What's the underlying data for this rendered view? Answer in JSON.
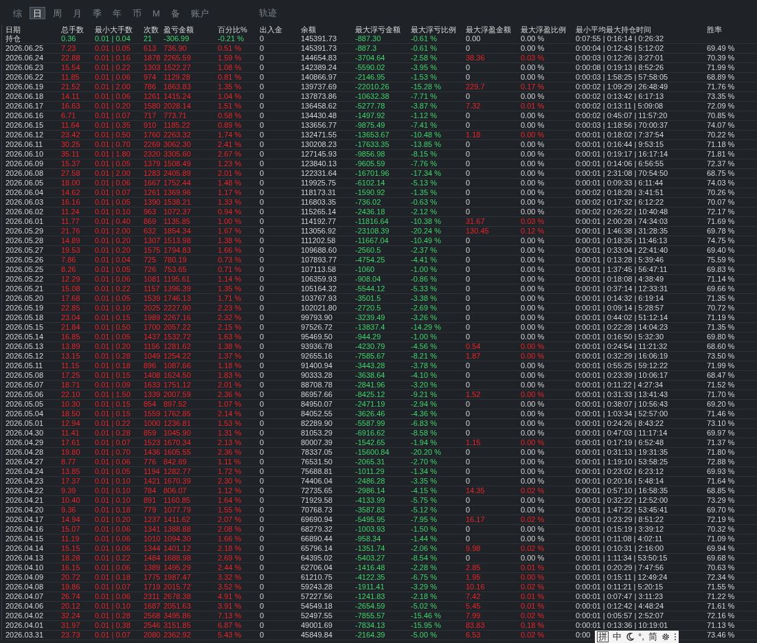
{
  "tabs": [
    {
      "label": "综",
      "selected": false
    },
    {
      "label": "日",
      "selected": true
    },
    {
      "label": "周",
      "selected": false
    },
    {
      "label": "月",
      "selected": false
    },
    {
      "label": "季",
      "selected": false
    },
    {
      "label": "年",
      "selected": false
    },
    {
      "label": "币",
      "selected": false
    },
    {
      "label": "M",
      "selected": false
    },
    {
      "label": "备",
      "selected": false
    },
    {
      "label": "账户",
      "selected": false
    }
  ],
  "trail_tab": {
    "label": "轨迹"
  },
  "table": {
    "columns": [
      "日期",
      "总手数",
      "最小大手数",
      "次数",
      "盈亏金额",
      "百分比%",
      "出入金",
      "余额",
      "最大浮亏金额",
      "最大浮亏比例",
      "最大浮盈金额",
      "最大浮盈比例",
      "最小平均最大持仓时间",
      "胜率"
    ],
    "rows": [
      {
        "profit": false,
        "float_gain": false,
        "cells": [
          "持仓",
          "0.36",
          "0.01 | 0.04",
          "21",
          "-306.99",
          "-0.21 %",
          "0",
          "145391.73",
          "-887.30",
          "-0.61 %",
          "0.00",
          "0.00 %",
          "0:07:55 | 0:16:14 | 0:26:32"
        ]
      },
      {
        "profit": true,
        "float_gain": false,
        "cells": [
          "2026.06.25",
          "7.23",
          "0.01 | 0.05",
          "613",
          "736.90",
          "0.51 %",
          "0",
          "145391.73",
          "-887.3",
          "-0.61 %",
          "0",
          "0.00 %",
          "0:00:04 | 0:12:43 | 5:12:02",
          "69.49 %"
        ]
      },
      {
        "profit": true,
        "float_gain": true,
        "cells": [
          "2026.06.24",
          "22.88",
          "0.01 | 0.16",
          "1878",
          "2265.59",
          "1.59 %",
          "0",
          "144654.83",
          "-3704.64",
          "-2.58 %",
          "38.36",
          "0.03 %",
          "0:00:03 | 0:12:26 | 3:27:01",
          "70.39 %"
        ]
      },
      {
        "profit": true,
        "float_gain": false,
        "cells": [
          "2026.06.23",
          "15.54",
          "0.01 | 0.22",
          "1303",
          "1522.27",
          "1.08 %",
          "0",
          "142389.24",
          "-5590.02",
          "-3.95 %",
          "0",
          "0.00 %",
          "0:00:08 | 0:19:13 | 8:52:26",
          "71.99 %"
        ]
      },
      {
        "profit": true,
        "float_gain": false,
        "cells": [
          "2026.06.22",
          "11.85",
          "0.01 | 0.06",
          "974",
          "1129.28",
          "0.81 %",
          "0",
          "140866.97",
          "-2146.95",
          "-1.53 %",
          "0",
          "0.00 %",
          "0:00:03 | 1:58:25 | 57:58:05",
          "68.89 %"
        ]
      },
      {
        "profit": true,
        "float_gain": true,
        "cells": [
          "2026.06.19",
          "21.52",
          "0.01 | 2.00",
          "786",
          "1863.83",
          "1.35 %",
          "0",
          "139737.69",
          "-22010.26",
          "-15.28 %",
          "229.7",
          "0.17 %",
          "0:00:02 | 1:09:29 | 26:48:49",
          "71.76 %"
        ]
      },
      {
        "profit": true,
        "float_gain": false,
        "cells": [
          "2026.06.18",
          "14.11",
          "0.01 | 0.06",
          "1261",
          "1415.24",
          "1.04 %",
          "0",
          "137873.86",
          "-10632.38",
          "-7.71 %",
          "0",
          "0.00 %",
          "0:00:02 | 0:13:42 | 6:17:13",
          "73.35 %"
        ]
      },
      {
        "profit": true,
        "float_gain": true,
        "cells": [
          "2026.06.17",
          "16.63",
          "0.01 | 0.20",
          "1580",
          "2028.14",
          "1.51 %",
          "0",
          "136458.62",
          "-5277.78",
          "-3.87 %",
          "7.32",
          "0.01 %",
          "0:00:02 | 0:13:11 | 5:09:08",
          "72.09 %"
        ]
      },
      {
        "profit": true,
        "float_gain": false,
        "cells": [
          "2026.06.16",
          "6.71",
          "0.01 | 0.07",
          "717",
          "773.71",
          "0.58 %",
          "0",
          "134430.48",
          "-1497.92",
          "-1.12 %",
          "0",
          "0.00 %",
          "0:00:02 | 0:45:07 | 11:57:20",
          "70.85 %"
        ]
      },
      {
        "profit": true,
        "float_gain": false,
        "cells": [
          "2026.06.15",
          "11.64",
          "0.01 | 0.35",
          "910",
          "1185.22",
          "0.89 %",
          "0",
          "133656.77",
          "-9875.49",
          "-7.41 %",
          "0",
          "0.00 %",
          "0:00:03 | 1:18:56 | 70:00:37",
          "74.07 %"
        ]
      },
      {
        "profit": true,
        "float_gain": true,
        "cells": [
          "2026.06.12",
          "23.42",
          "0.01 | 0.50",
          "1760",
          "2263.32",
          "1.74 %",
          "0",
          "132471.55",
          "-13653.67",
          "-10.48 %",
          "1.18",
          "0.00 %",
          "0:00:01 | 0:18:02 | 7:37:54",
          "70.22 %"
        ]
      },
      {
        "profit": true,
        "float_gain": false,
        "cells": [
          "2026.06.11",
          "30.25",
          "0.01 | 0.70",
          "2269",
          "3062.30",
          "2.41 %",
          "0",
          "130208.23",
          "-17633.35",
          "-13.85 %",
          "0",
          "0.00 %",
          "0:00:01 | 0:16:44 | 9:53:15",
          "71.18 %"
        ]
      },
      {
        "profit": true,
        "float_gain": false,
        "cells": [
          "2026.06.10",
          "35.11",
          "0.01 | 1.80",
          "2320",
          "3305.60",
          "2.67 %",
          "0",
          "127145.93",
          "-9856.98",
          "-8.15 %",
          "0",
          "0.00 %",
          "0:00:01 | 0:19:17 | 16:17:14",
          "71.81 %"
        ]
      },
      {
        "profit": true,
        "float_gain": false,
        "cells": [
          "2026.06.09",
          "15.37",
          "0.01 | 0.05",
          "1379",
          "1508.49",
          "1.23 %",
          "0",
          "123840.13",
          "-9605.59",
          "-7.76 %",
          "0",
          "0.00 %",
          "0:00:01 | 0:14:06 | 6:56:55",
          "72.37 %"
        ]
      },
      {
        "profit": true,
        "float_gain": false,
        "cells": [
          "2026.06.08",
          "27.58",
          "0.01 | 2.00",
          "1283",
          "2405.89",
          "2.01 %",
          "0",
          "122331.64",
          "-16701.96",
          "-17.34 %",
          "0",
          "0.00 %",
          "0:00:01 | 2:31:08 | 70:54:50",
          "68.75 %"
        ]
      },
      {
        "profit": true,
        "float_gain": false,
        "cells": [
          "2026.06.05",
          "18.00",
          "0.01 | 0.06",
          "1667",
          "1752.44",
          "1.48 %",
          "0",
          "119925.75",
          "-6102.14",
          "-5.13 %",
          "0",
          "0.00 %",
          "0:00:01 | 0:09:33 | 6:11:44",
          "74.03 %"
        ]
      },
      {
        "profit": true,
        "float_gain": false,
        "cells": [
          "2026.06.04",
          "14.62",
          "0.01 | 0.07",
          "1261",
          "1369.96",
          "1.17 %",
          "0",
          "118173.31",
          "-1590.92",
          "-1.35 %",
          "0",
          "0.00 %",
          "0:00:02 | 0:18:28 | 3:41:51",
          "70.26 %"
        ]
      },
      {
        "profit": true,
        "float_gain": false,
        "cells": [
          "2026.06.03",
          "16.16",
          "0.01 | 0.05",
          "1390",
          "1538.21",
          "1.33 %",
          "0",
          "116803.35",
          "-736.02",
          "-0.63 %",
          "0",
          "0.00 %",
          "0:00:02 | 0:17:32 | 6:12:22",
          "70.07 %"
        ]
      },
      {
        "profit": true,
        "float_gain": false,
        "cells": [
          "2026.06.02",
          "11.24",
          "0.01 | 0.10",
          "963",
          "1072.37",
          "0.94 %",
          "0",
          "115265.14",
          "-2436.18",
          "-2.12 %",
          "0",
          "0.00 %",
          "0:00:02 | 0:26:22 | 10:40:48",
          "72.17 %"
        ]
      },
      {
        "profit": true,
        "float_gain": true,
        "cells": [
          "2026.06.01",
          "11.77",
          "0.01 | 0.40",
          "869",
          "1135.85",
          "1.00 %",
          "0",
          "114192.77",
          "-11816.64",
          "-10.38 %",
          "31.67",
          "0.03 %",
          "0:00:01 | 2:00:28 | 74:34:03",
          "71.69 %"
        ]
      },
      {
        "profit": true,
        "float_gain": true,
        "cells": [
          "2026.05.29",
          "21.76",
          "0.01 | 2.00",
          "632",
          "1854.34",
          "1.67 %",
          "0",
          "113056.92",
          "-23108.39",
          "-20.24 %",
          "130.45",
          "0.12 %",
          "0:00:01 | 1:46:38 | 31:28:35",
          "69.78 %"
        ]
      },
      {
        "profit": true,
        "float_gain": false,
        "cells": [
          "2026.05.28",
          "14.89",
          "0.01 | 0.20",
          "1307",
          "1513.98",
          "1.38 %",
          "0",
          "111202.58",
          "-11667.04",
          "-10.49 %",
          "0",
          "0.00 %",
          "0:00:01 | 0:18:35 | 11:46:13",
          "74.75 %"
        ]
      },
      {
        "profit": true,
        "float_gain": false,
        "cells": [
          "2026.05.27",
          "19.53",
          "0.01 | 0.20",
          "1575",
          "1794.83",
          "1.66 %",
          "0",
          "109688.60",
          "-2560.5",
          "-2.37 %",
          "0",
          "0.00 %",
          "0:00:01 | 0:33:04 | 22:41:40",
          "69.40 %"
        ]
      },
      {
        "profit": true,
        "float_gain": false,
        "cells": [
          "2026.05.26",
          "7.86",
          "0.01 | 0.04",
          "725",
          "780.19",
          "0.73 %",
          "0",
          "107893.77",
          "-4754.25",
          "-4.41 %",
          "0",
          "0.00 %",
          "0:00:01 | 0:13:28 | 5:39:46",
          "75.59 %"
        ]
      },
      {
        "profit": true,
        "float_gain": false,
        "cells": [
          "2026.05.25",
          "8.26",
          "0.01 | 0.05",
          "726",
          "753.65",
          "0.71 %",
          "0",
          "107113.58",
          "-1060",
          "-1.00 %",
          "0",
          "0.00 %",
          "0:00:01 | 1:37:45 | 56:47:11",
          "69.83 %"
        ]
      },
      {
        "profit": true,
        "float_gain": false,
        "cells": [
          "2026.05.22",
          "12.29",
          "0.01 | 0.06",
          "1081",
          "1195.61",
          "1.14 %",
          "0",
          "106359.93",
          "-908.04",
          "-0.86 %",
          "0",
          "0.00 %",
          "0:00:01 | 0:18:08 | 4:38:49",
          "71.14 %"
        ]
      },
      {
        "profit": true,
        "float_gain": false,
        "cells": [
          "2026.05.21",
          "15.08",
          "0.01 | 0.22",
          "1157",
          "1396.39",
          "1.35 %",
          "0",
          "105164.32",
          "-5544.12",
          "-5.33 %",
          "0",
          "0.00 %",
          "0:00:01 | 0:37:14 | 12:33:31",
          "69.66 %"
        ]
      },
      {
        "profit": true,
        "float_gain": false,
        "cells": [
          "2026.05.20",
          "17.68",
          "0.01 | 0.05",
          "1539",
          "1746.13",
          "1.71 %",
          "0",
          "103767.93",
          "-3501.5",
          "-3.38 %",
          "0",
          "0.00 %",
          "0:00:01 | 0:14:32 | 6:19:14",
          "71.35 %"
        ]
      },
      {
        "profit": true,
        "float_gain": false,
        "cells": [
          "2026.05.19",
          "22.85",
          "0.01 | 0.10",
          "2025",
          "2227.90",
          "2.23 %",
          "0",
          "102021.80",
          "-2720.5",
          "-2.69 %",
          "0",
          "0.00 %",
          "0:00:01 | 0:09:14 | 5:28:57",
          "70.72 %"
        ]
      },
      {
        "profit": true,
        "float_gain": false,
        "cells": [
          "2026.05.18",
          "23.04",
          "0.01 | 0.15",
          "1989",
          "2267.16",
          "2.32 %",
          "0",
          "99793.90",
          "-3239.49",
          "-3.26 %",
          "0",
          "0.00 %",
          "0:00:01 | 0:44:02 | 51:12:14",
          "71.19 %"
        ]
      },
      {
        "profit": true,
        "float_gain": false,
        "cells": [
          "2026.05.15",
          "21.84",
          "0.01 | 0.50",
          "1700",
          "2057.22",
          "2.15 %",
          "0",
          "97526.72",
          "-13837.4",
          "-14.29 %",
          "0",
          "0.00 %",
          "0:00:01 | 0:22:28 | 14:04:23",
          "71.35 %"
        ]
      },
      {
        "profit": true,
        "float_gain": false,
        "cells": [
          "2026.05.14",
          "16.85",
          "0.01 | 0.05",
          "1437",
          "1532.72",
          "1.63 %",
          "0",
          "95469.50",
          "-944.29",
          "-1.00 %",
          "0",
          "0.00 %",
          "0:00:01 | 0:16:50 | 5:32:30",
          "69.80 %"
        ]
      },
      {
        "profit": true,
        "float_gain": true,
        "cells": [
          "2026.05.13",
          "13.89",
          "0.01 | 0.20",
          "1156",
          "1281.62",
          "1.38 %",
          "0",
          "93936.78",
          "-4230.79",
          "-4.56 %",
          "0.54",
          "0.00 %",
          "0:00:01 | 0:24:54 | 11:21:32",
          "68.60 %"
        ]
      },
      {
        "profit": true,
        "float_gain": true,
        "cells": [
          "2026.05.12",
          "13.15",
          "0.01 | 0.28",
          "1049",
          "1254.22",
          "1.37 %",
          "0",
          "92655.16",
          "-7585.67",
          "-8.21 %",
          "1.87",
          "0.00 %",
          "0:00:01 | 0:32:29 | 16:06:19",
          "73.50 %"
        ]
      },
      {
        "profit": true,
        "float_gain": false,
        "cells": [
          "2026.05.11",
          "11.15",
          "0.01 | 0.18",
          "896",
          "1087.66",
          "1.18 %",
          "0",
          "91400.94",
          "-3443.28",
          "-3.78 %",
          "0",
          "0.00 %",
          "0:00:01 | 0:55:25 | 59:12:22",
          "71.99 %"
        ]
      },
      {
        "profit": true,
        "float_gain": false,
        "cells": [
          "2026.05.08",
          "17.25",
          "0.01 | 0.15",
          "1408",
          "1624.50",
          "1.83 %",
          "0",
          "90333.28",
          "-3638.64",
          "-4.10 %",
          "0",
          "0.00 %",
          "0:00:01 | 0:23:39 | 10:06:17",
          "68.47 %"
        ]
      },
      {
        "profit": true,
        "float_gain": false,
        "cells": [
          "2026.05.07",
          "18.71",
          "0.01 | 0.09",
          "1633",
          "1751.12",
          "2.01 %",
          "0",
          "88708.78",
          "-2841.96",
          "-3.20 %",
          "0",
          "0.00 %",
          "0:00:01 | 0:11:22 | 4:27:34",
          "71.52 %"
        ]
      },
      {
        "profit": true,
        "float_gain": true,
        "cells": [
          "2026.05.06",
          "22.10",
          "0.01 | 1.50",
          "1339",
          "2007.59",
          "2.36 %",
          "0",
          "86957.66",
          "-8425.12",
          "-9.21 %",
          "1.52",
          "0.00 %",
          "0:00:01 | 0:31:33 | 13:41:43",
          "71.70 %"
        ]
      },
      {
        "profit": true,
        "float_gain": false,
        "cells": [
          "2026.05.05",
          "10.30",
          "0.01 | 0.15",
          "854",
          "897.52",
          "1.07 %",
          "0",
          "84950.07",
          "-2471.19",
          "-2.94 %",
          "0",
          "0.00 %",
          "0:00:01 | 0:38:07 | 10:56:43",
          "69.20 %"
        ]
      },
      {
        "profit": true,
        "float_gain": false,
        "cells": [
          "2026.05.04",
          "18.50",
          "0.01 | 0.15",
          "1559",
          "1762.85",
          "2.14 %",
          "0",
          "84052.55",
          "-3626.46",
          "-4.36 %",
          "0",
          "0.00 %",
          "0:00:01 | 1:03:34 | 52:57:00",
          "71.46 %"
        ]
      },
      {
        "profit": true,
        "float_gain": false,
        "cells": [
          "2026.05.01",
          "12.94",
          "0.01 | 0.22",
          "1000",
          "1236.81",
          "1.53 %",
          "0",
          "82289.90",
          "-5587.99",
          "-6.83 %",
          "0",
          "0.00 %",
          "0:00:01 | 0:24:26 | 8:43:22",
          "73.10 %"
        ]
      },
      {
        "profit": true,
        "float_gain": false,
        "cells": [
          "2026.04.30",
          "11.41",
          "0.01 | 0.28",
          "859",
          "1045.90",
          "1.31 %",
          "0",
          "81053.29",
          "-6916.62",
          "-8.58 %",
          "0",
          "0.00 %",
          "0:00:01 | 0:47:03 | 11:17:14",
          "69.97 %"
        ]
      },
      {
        "profit": true,
        "float_gain": true,
        "cells": [
          "2026.04.29",
          "17.61",
          "0.01 | 0.07",
          "1523",
          "1670.34",
          "2.13 %",
          "0",
          "80007.39",
          "-1542.65",
          "-1.94 %",
          "1.15",
          "0.00 %",
          "0:00:01 | 0:17:19 | 6:52:48",
          "71.37 %"
        ]
      },
      {
        "profit": true,
        "float_gain": false,
        "cells": [
          "2026.04.28",
          "19.80",
          "0.01 | 0.70",
          "1436",
          "1605.55",
          "2.36 %",
          "0",
          "78337.05",
          "-15600.84",
          "-20.20 %",
          "0",
          "0.00 %",
          "0:00:01 | 0:31:13 | 19:31:35",
          "71.80 %"
        ]
      },
      {
        "profit": true,
        "float_gain": false,
        "cells": [
          "2026.04.27",
          "8.77",
          "0.01 | 0.06",
          "776",
          "842.69",
          "1.11 %",
          "0",
          "76531.50",
          "-2065.31",
          "-2.70 %",
          "0",
          "0.00 %",
          "0:00:01 | 1:19:10 | 53:58:25",
          "72.88 %"
        ]
      },
      {
        "profit": true,
        "float_gain": false,
        "cells": [
          "2026.04.24",
          "13.85",
          "0.01 | 0.05",
          "1194",
          "1282.77",
          "1.72 %",
          "0",
          "75688.81",
          "-1011.29",
          "-1.34 %",
          "0",
          "0.00 %",
          "0:00:01 | 0:23:02 | 6:23:12",
          "69.93 %"
        ]
      },
      {
        "profit": true,
        "float_gain": false,
        "cells": [
          "2026.04.23",
          "17.37",
          "0.01 | 0.10",
          "1421",
          "1670.39",
          "2.30 %",
          "0",
          "74406.04",
          "-2486.28",
          "-3.35 %",
          "0",
          "0.00 %",
          "0:00:01 | 0:20:16 | 5:48:14",
          "71.64 %"
        ]
      },
      {
        "profit": true,
        "float_gain": true,
        "cells": [
          "2026.04.22",
          "9.39",
          "0.01 | 0.10",
          "784",
          "806.07",
          "1.12 %",
          "0",
          "72735.65",
          "-2986.14",
          "-4.15 %",
          "14.35",
          "0.02 %",
          "0:00:01 | 0:57:10 | 16:58:35",
          "68.85 %"
        ]
      },
      {
        "profit": true,
        "float_gain": false,
        "cells": [
          "2026.04.21",
          "10.40",
          "0.01 | 0.10",
          "891",
          "1160.85",
          "1.64 %",
          "0",
          "71929.58",
          "-4133.99",
          "-5.75 %",
          "0",
          "0.00 %",
          "0:00:01 | 0:32:22 | 12:52:00",
          "73.29 %"
        ]
      },
      {
        "profit": true,
        "float_gain": false,
        "cells": [
          "2026.04.20",
          "9.36",
          "0.01 | 0.18",
          "779",
          "1077.79",
          "1.55 %",
          "0",
          "70768.73",
          "-3587.83",
          "-5.12 %",
          "0",
          "0.00 %",
          "0:00:01 | 1:47:22 | 53:45:41",
          "69.70 %"
        ]
      },
      {
        "profit": true,
        "float_gain": true,
        "cells": [
          "2026.04.17",
          "14.94",
          "0.01 | 0.20",
          "1237",
          "1411.62",
          "2.07 %",
          "0",
          "69690.94",
          "-5495.95",
          "-7.95 %",
          "16.17",
          "0.02 %",
          "0:00:01 | 0:23:29 | 8:51:22",
          "72.19 %"
        ]
      },
      {
        "profit": true,
        "float_gain": false,
        "cells": [
          "2026.04.16",
          "15.07",
          "0.01 | 0.06",
          "1341",
          "1388.88",
          "2.08 %",
          "0",
          "68279.32",
          "-1003.93",
          "-1.50 %",
          "0",
          "0.00 %",
          "0:00:01 | 0:15:19 | 3:39:12",
          "70.32 %"
        ]
      },
      {
        "profit": true,
        "float_gain": false,
        "cells": [
          "2026.04.15",
          "11.19",
          "0.01 | 0.06",
          "1010",
          "1094.30",
          "1.66 %",
          "0",
          "66890.44",
          "-958.34",
          "-1.44 %",
          "0",
          "0.00 %",
          "0:00:01 | 0:11:08 | 4:02:11",
          "71.09 %"
        ]
      },
      {
        "profit": true,
        "float_gain": true,
        "cells": [
          "2026.04.14",
          "15.15",
          "0.01 | 0.06",
          "1344",
          "1401.12",
          "2.18 %",
          "0",
          "65796.14",
          "-1351.74",
          "-2.06 %",
          "9.98",
          "0.02 %",
          "0:00:01 | 0:10:31 | 2:16:00",
          "69.94 %"
        ]
      },
      {
        "profit": true,
        "float_gain": false,
        "cells": [
          "2026.04.13",
          "18.28",
          "0.01 | 0.22",
          "1484",
          "1688.98",
          "2.69 %",
          "0",
          "64395.02",
          "-5403.27",
          "-8.54 %",
          "0",
          "0.00 %",
          "0:00:01 | 1:11:34 | 53:50:15",
          "69.68 %"
        ]
      },
      {
        "profit": true,
        "float_gain": true,
        "cells": [
          "2026.04.10",
          "16.15",
          "0.01 | 0.06",
          "1389",
          "1495.29",
          "2.44 %",
          "0",
          "62706.04",
          "-1416.48",
          "-2.28 %",
          "2.85",
          "0.01 %",
          "0:00:01 | 0:20:29 | 7:47:56",
          "70.63 %"
        ]
      },
      {
        "profit": true,
        "float_gain": true,
        "cells": [
          "2026.04.09",
          "20.72",
          "0.01 | 0.18",
          "1775",
          "1987.47",
          "3.32 %",
          "0",
          "61210.75",
          "-4122.35",
          "-6.75 %",
          "1.95",
          "0.00 %",
          "0:00:01 | 0:15:11 | 12:49:24",
          "72.34 %"
        ]
      },
      {
        "profit": true,
        "float_gain": true,
        "cells": [
          "2026.04.08",
          "19.86",
          "0.01 | 0.07",
          "1719",
          "2015.72",
          "3.52 %",
          "0",
          "59243.28",
          "-1911.41",
          "-3.29 %",
          "10.16",
          "0.02 %",
          "0:00:01 | 0:11:21 | 5:20:15",
          "71.55 %"
        ]
      },
      {
        "profit": true,
        "float_gain": true,
        "cells": [
          "2026.04.07",
          "26.74",
          "0.01 | 0.06",
          "2311",
          "2678.38",
          "4.91 %",
          "0",
          "57227.56",
          "-1241.83",
          "-2.18 %",
          "7.42",
          "0.01 %",
          "0:00:01 | 0:07:47 | 3:11:23",
          "71.22 %"
        ]
      },
      {
        "profit": true,
        "float_gain": true,
        "cells": [
          "2026.04.06",
          "20.12",
          "0.01 | 0.10",
          "1687",
          "2051.63",
          "3.91 %",
          "0",
          "54549.18",
          "-2654.59",
          "-5.02 %",
          "5.45",
          "0.01 %",
          "0:00:01 | 0:12:42 | 4:48:24",
          "71.61 %"
        ]
      },
      {
        "profit": true,
        "float_gain": true,
        "cells": [
          "2026.04.02",
          "32.24",
          "0.01 | 0.28",
          "2568",
          "3495.86",
          "7.13 %",
          "0",
          "52497.55",
          "-7855.57",
          "-15.46 %",
          "7.99",
          "0.02 %",
          "0:00:01 | 0:05:57 | 2:52:07",
          "72.16 %"
        ]
      },
      {
        "profit": true,
        "float_gain": true,
        "cells": [
          "2026.04.01",
          "31.97",
          "0.01 | 0.38",
          "2546",
          "3151.85",
          "6.87 %",
          "0",
          "49001.69",
          "-7834.13",
          "-15.95 %",
          "83.83",
          "0.18 %",
          "0:00:01 | 0:13:36 | 10:19:01",
          "71.13 %"
        ]
      },
      {
        "profit": true,
        "float_gain": true,
        "cells": [
          "2026.03.31",
          "23.73",
          "0.01 | 0.07",
          "2080",
          "2362.92",
          "5.43 %",
          "0",
          "45849.84",
          "-2164.39",
          "-5.00 %",
          "6.53",
          "0.02 %",
          "0:00",
          "73.46 %"
        ]
      }
    ]
  },
  "ime_toolbar": {
    "items": [
      "拼",
      "中",
      "°,",
      "简"
    ]
  }
}
